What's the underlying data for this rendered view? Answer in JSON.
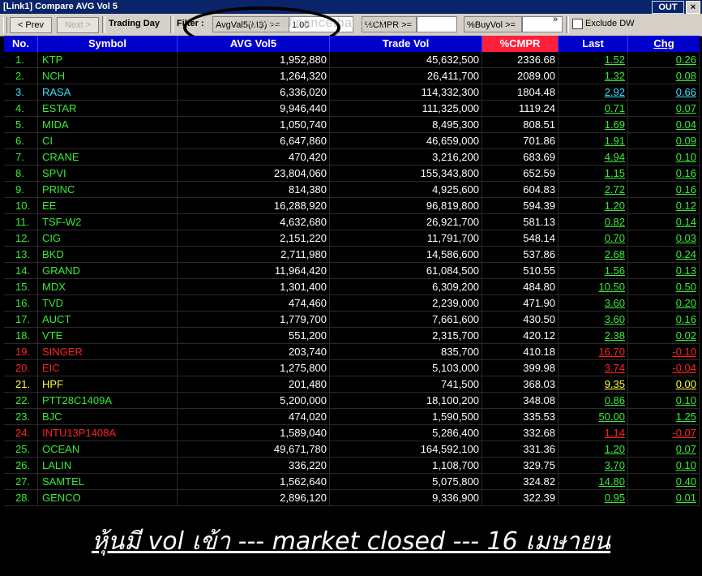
{
  "window": {
    "title": "[Link1] Compare AVG Vol 5",
    "out_label": "OUT",
    "close_label": "×"
  },
  "toolbar": {
    "prev_label": "< Prev",
    "next_label": "Next >",
    "trading_day_label": "Trading Day",
    "filter_label": "Filter :",
    "avgvol_label": "AvgVal5(M฿) >=",
    "avgvol_value": "1.00",
    "cmpr_label": "%CMPR >=",
    "cmpr_value": "",
    "buyvol_label": "%BuyVol >=",
    "buyvol_value": "",
    "more_icon": "»",
    "exclude_label": "Exclude DW",
    "watermark": "www.efinancethai.com"
  },
  "columns": [
    "No.",
    "Symbol",
    "AVG Vol5",
    "Trade Vol",
    "%CMPR",
    "Last",
    "Chg"
  ],
  "colors": {
    "up": "#33ee33",
    "down": "#ff2222",
    "flat": "#ffff33",
    "cyan": "#33e0ff",
    "header": "#0000cc",
    "selected_header": "#ff1f3b"
  },
  "rows": [
    {
      "no": "1.",
      "symbol": "KTP",
      "avg": "1,952,880",
      "vol": "45,632,500",
      "cmpr": "2336.68",
      "last": "1.52",
      "chg": "0.26",
      "color": "up"
    },
    {
      "no": "2.",
      "symbol": "NCH",
      "avg": "1,264,320",
      "vol": "26,411,700",
      "cmpr": "2089.00",
      "last": "1.32",
      "chg": "0.08",
      "color": "up"
    },
    {
      "no": "3.",
      "symbol": "RASA",
      "avg": "6,336,020",
      "vol": "114,332,300",
      "cmpr": "1804.48",
      "last": "2.92",
      "chg": "0.66",
      "color": "cyan"
    },
    {
      "no": "4.",
      "symbol": "ESTAR",
      "avg": "9,946,440",
      "vol": "111,325,000",
      "cmpr": "1119.24",
      "last": "0.71",
      "chg": "0.07",
      "color": "up"
    },
    {
      "no": "5.",
      "symbol": "MIDA",
      "avg": "1,050,740",
      "vol": "8,495,300",
      "cmpr": "808.51",
      "last": "1.69",
      "chg": "0.04",
      "color": "up"
    },
    {
      "no": "6.",
      "symbol": "CI",
      "avg": "6,647,860",
      "vol": "46,659,000",
      "cmpr": "701.86",
      "last": "1.91",
      "chg": "0.09",
      "color": "up"
    },
    {
      "no": "7.",
      "symbol": "CRANE",
      "avg": "470,420",
      "vol": "3,216,200",
      "cmpr": "683.69",
      "last": "4.94",
      "chg": "0.10",
      "color": "up"
    },
    {
      "no": "8.",
      "symbol": "SPVI",
      "avg": "23,804,060",
      "vol": "155,343,800",
      "cmpr": "652.59",
      "last": "1.15",
      "chg": "0.16",
      "color": "up"
    },
    {
      "no": "9.",
      "symbol": "PRINC",
      "avg": "814,380",
      "vol": "4,925,600",
      "cmpr": "604.83",
      "last": "2.72",
      "chg": "0.16",
      "color": "up"
    },
    {
      "no": "10.",
      "symbol": "EE",
      "avg": "16,288,920",
      "vol": "96,819,800",
      "cmpr": "594.39",
      "last": "1.20",
      "chg": "0.12",
      "color": "up"
    },
    {
      "no": "11.",
      "symbol": "TSF-W2",
      "avg": "4,632,680",
      "vol": "26,921,700",
      "cmpr": "581.13",
      "last": "0.82",
      "chg": "0.14",
      "color": "up"
    },
    {
      "no": "12.",
      "symbol": "CIG",
      "avg": "2,151,220",
      "vol": "11,791,700",
      "cmpr": "548.14",
      "last": "0.70",
      "chg": "0.03",
      "color": "up"
    },
    {
      "no": "13.",
      "symbol": "BKD",
      "avg": "2,711,980",
      "vol": "14,586,600",
      "cmpr": "537.86",
      "last": "2.68",
      "chg": "0.24",
      "color": "up"
    },
    {
      "no": "14.",
      "symbol": "GRAND",
      "avg": "11,964,420",
      "vol": "61,084,500",
      "cmpr": "510.55",
      "last": "1.56",
      "chg": "0.13",
      "color": "up"
    },
    {
      "no": "15.",
      "symbol": "MDX",
      "avg": "1,301,400",
      "vol": "6,309,200",
      "cmpr": "484.80",
      "last": "10.50",
      "chg": "0.50",
      "color": "up"
    },
    {
      "no": "16.",
      "symbol": "TVD",
      "avg": "474,460",
      "vol": "2,239,000",
      "cmpr": "471.90",
      "last": "3.60",
      "chg": "0.20",
      "color": "up"
    },
    {
      "no": "17.",
      "symbol": "AUCT",
      "avg": "1,779,700",
      "vol": "7,661,600",
      "cmpr": "430.50",
      "last": "3.60",
      "chg": "0.16",
      "color": "up"
    },
    {
      "no": "18.",
      "symbol": "VTE",
      "avg": "551,200",
      "vol": "2,315,700",
      "cmpr": "420.12",
      "last": "2.38",
      "chg": "0.02",
      "color": "up"
    },
    {
      "no": "19.",
      "symbol": "SINGER",
      "avg": "203,740",
      "vol": "835,700",
      "cmpr": "410.18",
      "last": "16.70",
      "chg": "-0.10",
      "color": "down"
    },
    {
      "no": "20.",
      "symbol": "EIC",
      "avg": "1,275,800",
      "vol": "5,103,000",
      "cmpr": "399.98",
      "last": "3.74",
      "chg": "-0.04",
      "color": "down"
    },
    {
      "no": "21.",
      "symbol": "HPF",
      "avg": "201,480",
      "vol": "741,500",
      "cmpr": "368.03",
      "last": "9.35",
      "chg": "0.00",
      "color": "flat"
    },
    {
      "no": "22.",
      "symbol": "PTT28C1409A",
      "avg": "5,200,000",
      "vol": "18,100,200",
      "cmpr": "348.08",
      "last": "0.86",
      "chg": "0.10",
      "color": "up"
    },
    {
      "no": "23.",
      "symbol": "BJC",
      "avg": "474,020",
      "vol": "1,590,500",
      "cmpr": "335.53",
      "last": "50.00",
      "chg": "1.25",
      "color": "up"
    },
    {
      "no": "24.",
      "symbol": "INTU13P1408A",
      "avg": "1,589,040",
      "vol": "5,286,400",
      "cmpr": "332.68",
      "last": "1.14",
      "chg": "-0.07",
      "color": "down"
    },
    {
      "no": "25.",
      "symbol": "OCEAN",
      "avg": "49,671,780",
      "vol": "164,592,100",
      "cmpr": "331.36",
      "last": "1.20",
      "chg": "0.07",
      "color": "up"
    },
    {
      "no": "26.",
      "symbol": "LALIN",
      "avg": "336,220",
      "vol": "1,108,700",
      "cmpr": "329.75",
      "last": "3.70",
      "chg": "0.10",
      "color": "up"
    },
    {
      "no": "27.",
      "symbol": "SAMTEL",
      "avg": "1,562,640",
      "vol": "5,075,800",
      "cmpr": "324.82",
      "last": "14.80",
      "chg": "0.40",
      "color": "up"
    },
    {
      "no": "28.",
      "symbol": "GENCO",
      "avg": "2,896,120",
      "vol": "9,336,900",
      "cmpr": "322.39",
      "last": "0.95",
      "chg": "0.01",
      "color": "up"
    }
  ],
  "caption": "หุ้นมี vol เข้า --- market closed --- 16 เมษายน"
}
